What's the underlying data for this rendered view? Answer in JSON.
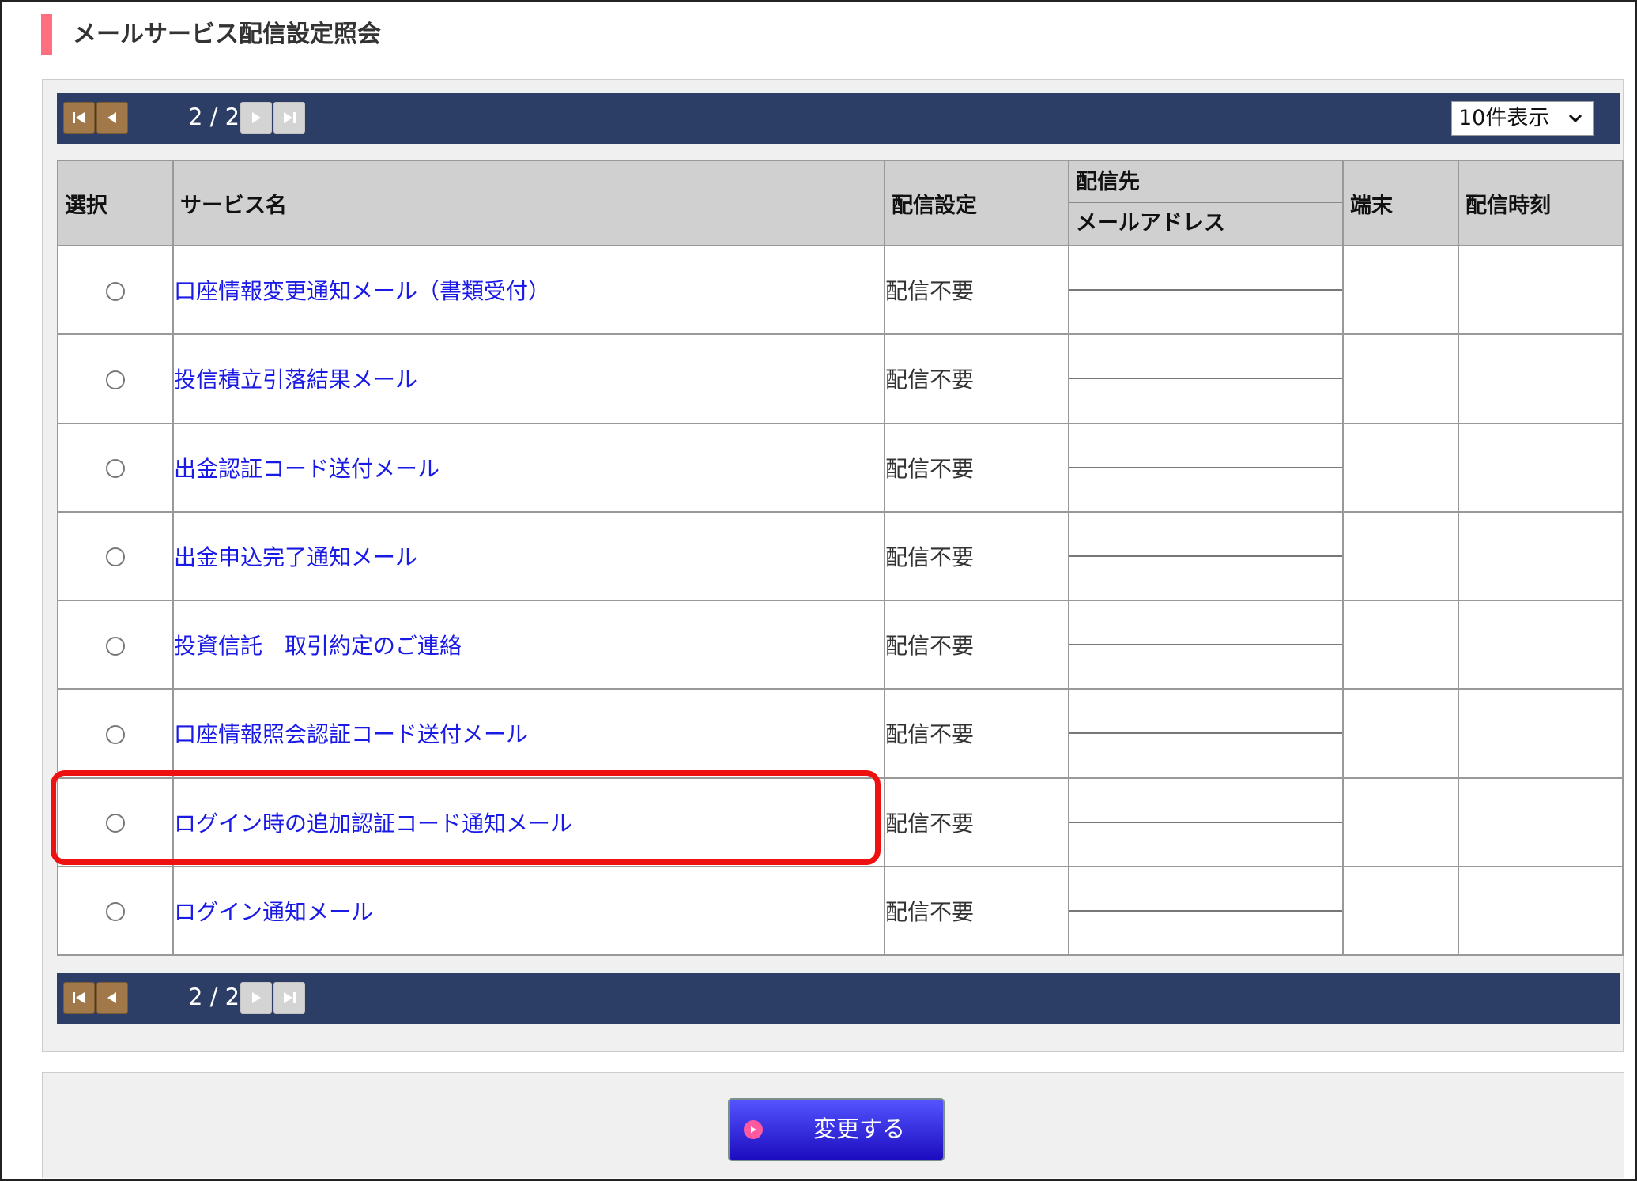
{
  "page": {
    "title": "メールサービス配信設定照会"
  },
  "pager": {
    "count_text": "2 / 2",
    "per_page": "10件表示",
    "icons": [
      "first-page-icon",
      "prev-page-icon",
      "next-page-icon",
      "last-page-icon"
    ]
  },
  "table": {
    "headers": {
      "select": "選択",
      "service_name": "サービス名",
      "setting": "配信設定",
      "destination": "配信先",
      "email": "メールアドレス",
      "device": "端末",
      "time": "配信時刻"
    },
    "rows": [
      {
        "name": "口座情報変更通知メール（書類受付）",
        "setting": "配信不要"
      },
      {
        "name": "投信積立引落結果メール",
        "setting": "配信不要"
      },
      {
        "name": "出金認証コード送付メール",
        "setting": "配信不要"
      },
      {
        "name": "出金申込完了通知メール",
        "setting": "配信不要"
      },
      {
        "name": "投資信託　取引約定のご連絡",
        "setting": "配信不要"
      },
      {
        "name": "口座情報照会認証コード送付メール",
        "setting": "配信不要"
      },
      {
        "name": "ログイン時の追加認証コード通知メール",
        "setting": "配信不要"
      },
      {
        "name": "ログイン通知メール",
        "setting": "配信不要"
      }
    ]
  },
  "actions": {
    "change_label": "変更する"
  },
  "colors": {
    "header_bar": "#2c3d66",
    "link": "#1a1ae6",
    "highlight": "#ee1111",
    "title_accent": "#ff6f7f",
    "button": "#2a1ee0"
  }
}
